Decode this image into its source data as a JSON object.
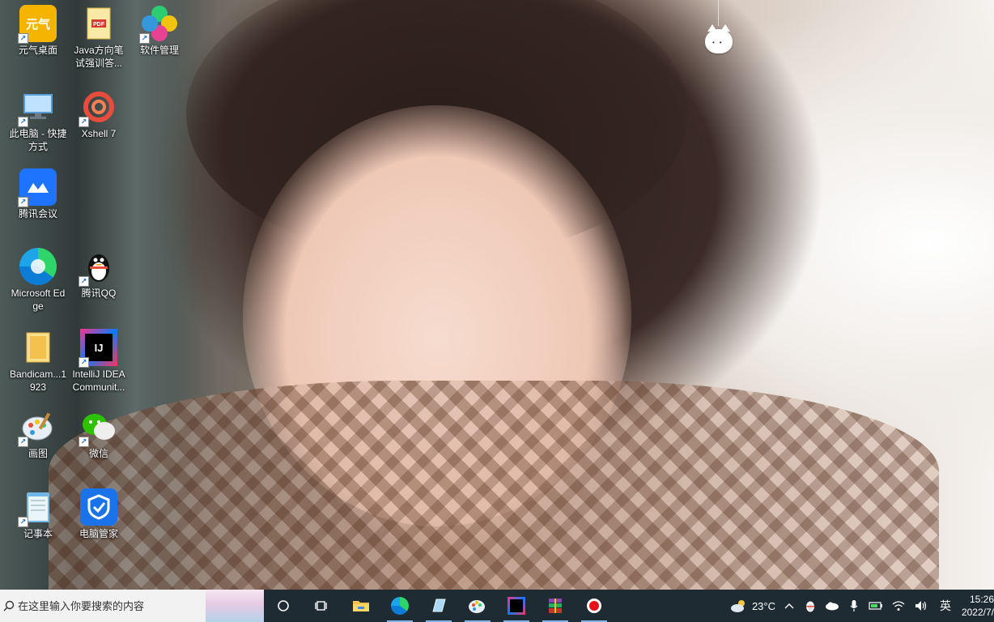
{
  "desktop": {
    "icons": [
      {
        "label": "元气桌面",
        "glyph": "元气",
        "color": "#f5b400"
      },
      {
        "label": "Java方向笔试强训答...",
        "glyph": "PDF",
        "color": "#f3c84a"
      },
      {
        "label": "软件管理",
        "glyph": "",
        "color": "#2ecc71"
      },
      {
        "label": "此电脑 - 快捷方式",
        "glyph": "",
        "color": "#4aa3df"
      },
      {
        "label": "Xshell 7",
        "glyph": "",
        "color": "#e74c3c"
      },
      {
        "label": "腾讯会议",
        "glyph": "",
        "color": "#1e74ff"
      },
      {
        "label": "Microsoft Edge",
        "glyph": "",
        "color": "#0c7cd5"
      },
      {
        "label": "腾讯QQ",
        "glyph": "",
        "color": "#111111"
      },
      {
        "label": "Bandicam...1923",
        "glyph": "",
        "color": "#f2c14e"
      },
      {
        "label": "IntelliJ IDEA Communit...",
        "glyph": "IJ",
        "color": "#000000"
      },
      {
        "label": "画图",
        "glyph": "",
        "color": "#f5a623"
      },
      {
        "label": "微信",
        "glyph": "",
        "color": "#2dc100"
      },
      {
        "label": "记事本",
        "glyph": "",
        "color": "#6fb8e8"
      },
      {
        "label": "电脑管家",
        "glyph": "",
        "color": "#1a73e8"
      }
    ]
  },
  "taskbar": {
    "search_placeholder": "在这里输入你要搜索的内容",
    "apps": [
      {
        "name": "cortana-button",
        "icon": "cortana-icon"
      },
      {
        "name": "task-view-button",
        "icon": "task-view-icon"
      },
      {
        "name": "file-explorer-button",
        "icon": "folder-icon"
      },
      {
        "name": "edge-button",
        "icon": "edge-icon"
      },
      {
        "name": "notepad-button",
        "icon": "notepad-icon"
      },
      {
        "name": "paint-button",
        "icon": "paint-icon"
      },
      {
        "name": "intellij-button",
        "icon": "intellij-icon"
      },
      {
        "name": "winrar-button",
        "icon": "winrar-icon"
      },
      {
        "name": "recorder-button",
        "icon": "record-icon"
      }
    ],
    "weather": "23°C",
    "ime": "英",
    "time": "15:26",
    "date": "2022/7/"
  }
}
